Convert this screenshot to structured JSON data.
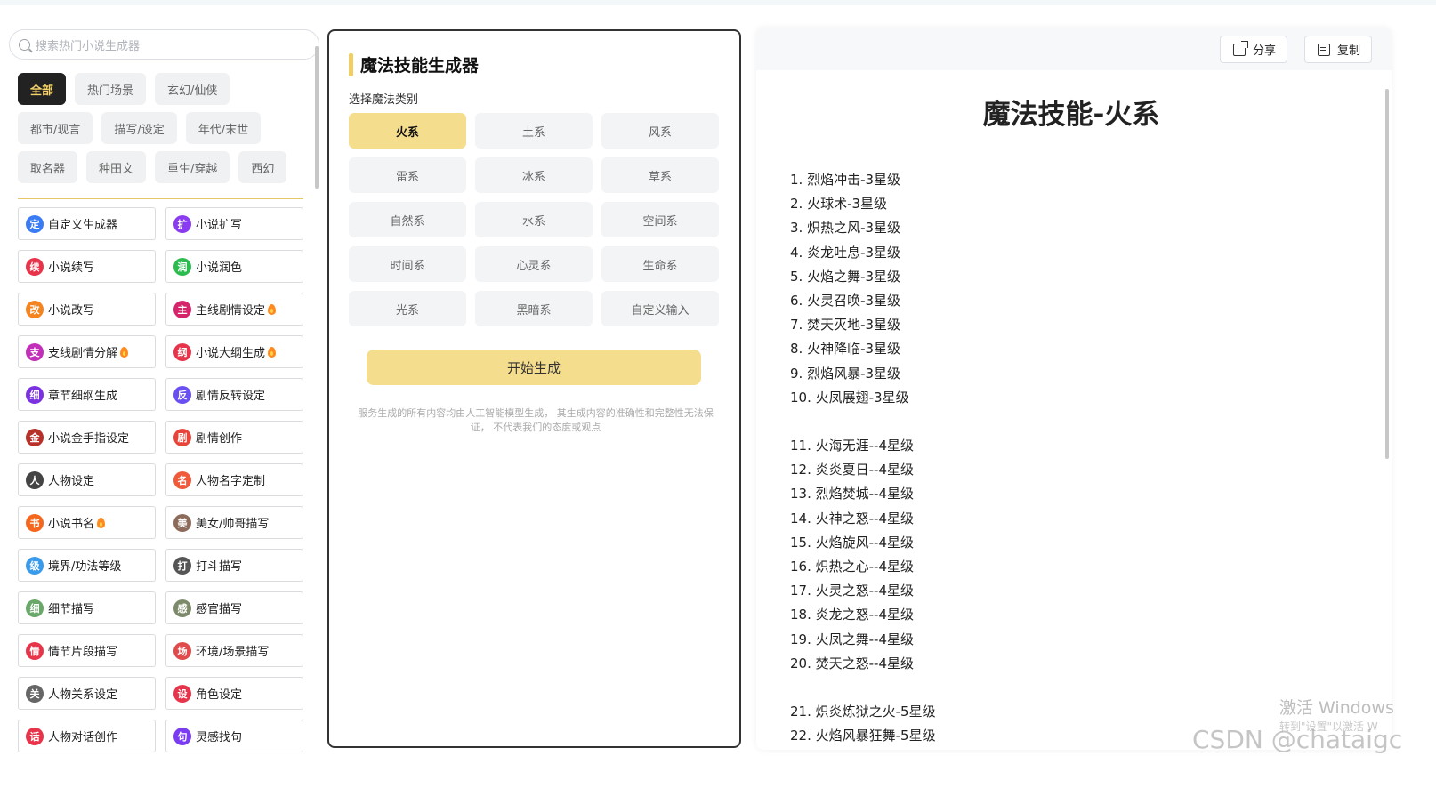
{
  "sidebar": {
    "search_placeholder": "搜索热门小说生成器",
    "categories": [
      "全部",
      "热门场景",
      "玄幻/仙侠",
      "都市/现言",
      "描写/设定",
      "年代/末世",
      "取名器",
      "种田文",
      "重生/穿越",
      "西幻"
    ],
    "tools": [
      {
        "label": "自定义生成器",
        "icon": "定",
        "color": "#3b7cf5",
        "hot": false
      },
      {
        "label": "小说扩写",
        "icon": "扩",
        "color": "#8a3cf0",
        "hot": false
      },
      {
        "label": "小说续写",
        "icon": "续",
        "color": "#e8344a",
        "hot": false
      },
      {
        "label": "小说润色",
        "icon": "润",
        "color": "#2bbb4f",
        "hot": false
      },
      {
        "label": "小说改写",
        "icon": "改",
        "color": "#f5841f",
        "hot": false
      },
      {
        "label": "主线剧情设定",
        "icon": "主",
        "color": "#d6246b",
        "hot": true
      },
      {
        "label": "支线剧情分解",
        "icon": "支",
        "color": "#c22fb8",
        "hot": true
      },
      {
        "label": "小说大纲生成",
        "icon": "纲",
        "color": "#e8344a",
        "hot": true
      },
      {
        "label": "章节细纲生成",
        "icon": "细",
        "color": "#7a32e0",
        "hot": false
      },
      {
        "label": "剧情反转设定",
        "icon": "反",
        "color": "#6a4ff2",
        "hot": false
      },
      {
        "label": "小说金手指设定",
        "icon": "金",
        "color": "#b8302a",
        "hot": false
      },
      {
        "label": "剧情创作",
        "icon": "剧",
        "color": "#e8453a",
        "hot": false
      },
      {
        "label": "人物设定",
        "icon": "人",
        "color": "#444444",
        "hot": false
      },
      {
        "label": "人物名字定制",
        "icon": "名",
        "color": "#f0593a",
        "hot": false
      },
      {
        "label": "小说书名",
        "icon": "书",
        "color": "#f5671f",
        "hot": true
      },
      {
        "label": "美女/帅哥描写",
        "icon": "美",
        "color": "#8d6b5a",
        "hot": false
      },
      {
        "label": "境界/功法等级",
        "icon": "级",
        "color": "#3a9bea",
        "hot": false
      },
      {
        "label": "打斗描写",
        "icon": "打",
        "color": "#555555",
        "hot": false
      },
      {
        "label": "细节描写",
        "icon": "细",
        "color": "#6aa86a",
        "hot": false
      },
      {
        "label": "感官描写",
        "icon": "感",
        "color": "#7d8a6a",
        "hot": false
      },
      {
        "label": "情节片段描写",
        "icon": "情",
        "color": "#e8344a",
        "hot": false
      },
      {
        "label": "环境/场景描写",
        "icon": "场",
        "color": "#e04a4a",
        "hot": false
      },
      {
        "label": "人物关系设定",
        "icon": "关",
        "color": "#666666",
        "hot": false
      },
      {
        "label": "角色设定",
        "icon": "设",
        "color": "#e8344a",
        "hot": false
      },
      {
        "label": "人物对话创作",
        "icon": "话",
        "color": "#e8344a",
        "hot": false
      },
      {
        "label": "灵感找句",
        "icon": "句",
        "color": "#7a3cf0",
        "hot": false
      }
    ]
  },
  "panel": {
    "title": "魔法技能生成器",
    "subtitle": "选择魔法类别",
    "options": [
      "火系",
      "土系",
      "风系",
      "雷系",
      "冰系",
      "草系",
      "自然系",
      "水系",
      "空间系",
      "时间系",
      "心灵系",
      "生命系",
      "光系",
      "黑暗系",
      "自定义输入"
    ],
    "selected": "火系",
    "start_label": "开始生成",
    "disclaimer": "服务生成的所有内容均由人工智能模型生成， 其生成内容的准确性和完整性无法保证， 不代表我们的态度或观点",
    "accent": "#f5dd8e"
  },
  "output": {
    "share_label": "分享",
    "copy_label": "复制",
    "title": "魔法技能-火系",
    "lines": [
      "1. 烈焰冲击-3星级",
      "2. 火球术-3星级",
      "3. 炽热之风-3星级",
      "4. 炎龙吐息-3星级",
      "5. 火焰之舞-3星级",
      "6. 火灵召唤-3星级",
      "7. 焚天灭地-3星级",
      "8. 火神降临-3星级",
      "9. 烈焰风暴-3星级",
      "10. 火凤展翅-3星级",
      "",
      "11. 火海无涯--4星级",
      "12. 炎炎夏日--4星级",
      "13. 烈焰焚城--4星级",
      "14. 火神之怒--4星级",
      "15. 火焰旋风--4星级",
      "16. 炽热之心--4星级",
      "17. 火灵之怒--4星级",
      "18. 炎龙之怒--4星级",
      "19. 火凤之舞--4星级",
      "20. 焚天之怒--4星级",
      "",
      "21. 炽炎炼狱之火-5星级",
      "22. 火焰风暴狂舞-5星级"
    ]
  },
  "watermark": {
    "windows_line1": "激活 Windows",
    "windows_line2": "转到\"设置\"以激活 W",
    "csdn": "CSDN @chataigc"
  }
}
